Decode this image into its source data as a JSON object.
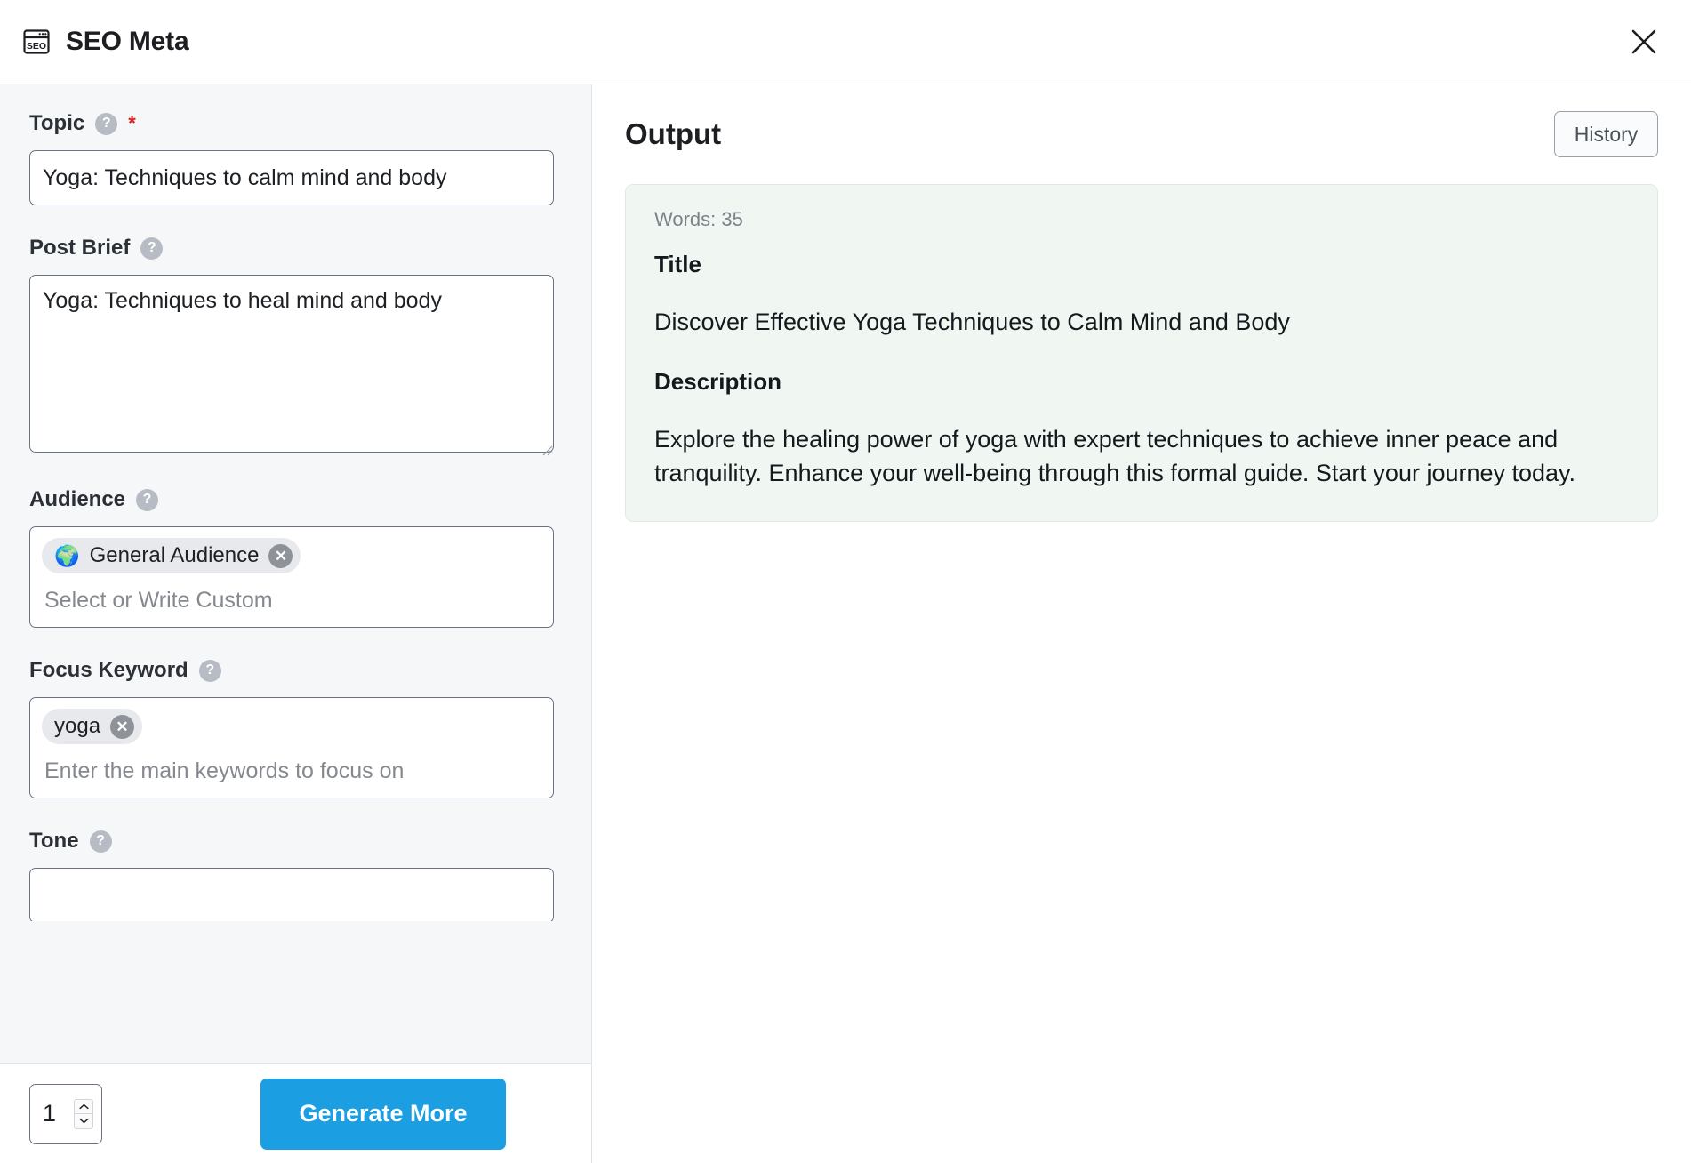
{
  "header": {
    "icon": "seo-window-icon",
    "title": "SEO Meta",
    "close_label": "✕"
  },
  "form": {
    "topic": {
      "label": "Topic",
      "help": "?",
      "required_mark": "*",
      "value": "Yoga: Techniques to calm mind and body"
    },
    "post_brief": {
      "label": "Post Brief",
      "help": "?",
      "value": "Yoga: Techniques to heal mind and body"
    },
    "audience": {
      "label": "Audience",
      "help": "?",
      "placeholder": "Select or Write Custom",
      "tags": [
        {
          "emoji": "🌍",
          "label": "General Audience",
          "remove": "✕"
        }
      ]
    },
    "focus_keyword": {
      "label": "Focus Keyword",
      "help": "?",
      "placeholder": "Enter the main keywords to focus on",
      "tags": [
        {
          "label": "yoga",
          "remove": "✕"
        }
      ]
    },
    "tone": {
      "label": "Tone",
      "help": "?"
    }
  },
  "footer": {
    "quantity": "1",
    "spinner_up": "⌃",
    "spinner_down": "⌄",
    "generate_label": "Generate More"
  },
  "output": {
    "title": "Output",
    "history_label": "History",
    "result": {
      "words_label": "Words: 35",
      "title_heading": "Title",
      "title_text": "Discover Effective Yoga Techniques to Calm Mind and Body",
      "description_heading": "Description",
      "description_text": "Explore the healing power of yoga with expert techniques to achieve inner peace and tranquility. Enhance your well-being through this formal guide. Start your journey today."
    }
  },
  "colors": {
    "accent_blue": "#1b9ee2",
    "panel_bg": "#f6f7f9",
    "card_bg": "#f0f7f3",
    "required_red": "#e02020"
  }
}
